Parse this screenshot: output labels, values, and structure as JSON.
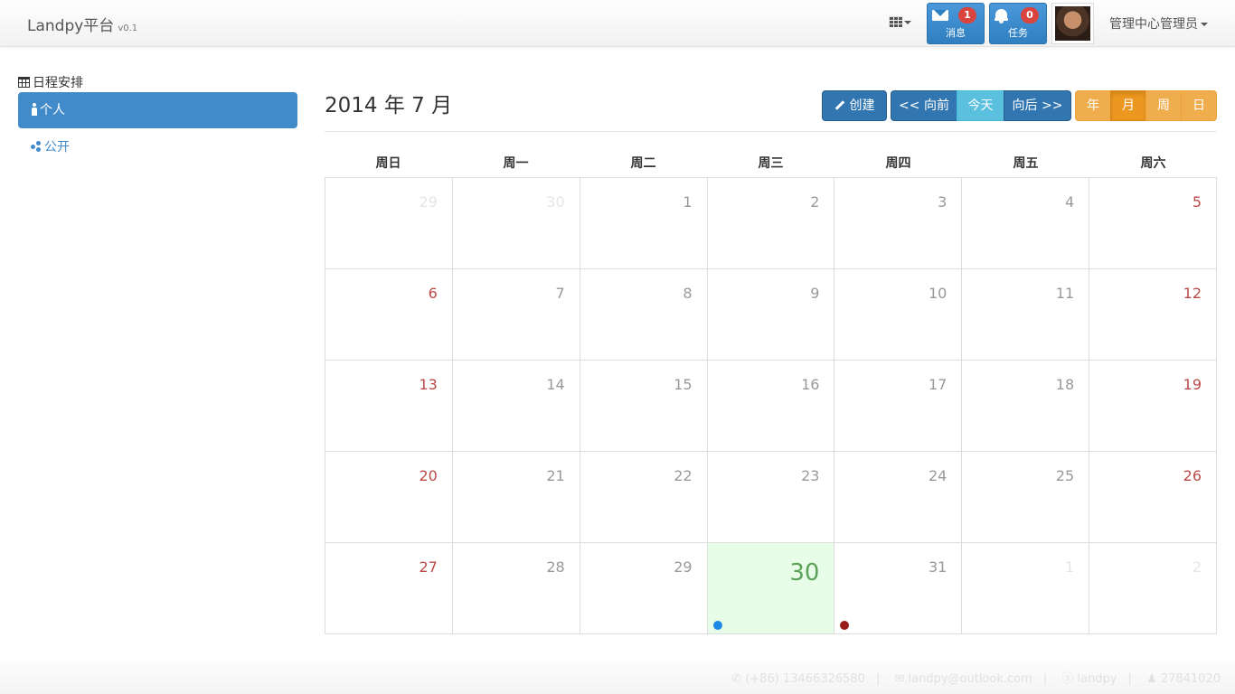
{
  "navbar": {
    "brand": "Landpy平台",
    "version": "v0.1",
    "messages": {
      "label": "消息",
      "count": "1"
    },
    "tasks": {
      "label": "任务",
      "count": "0"
    },
    "user": "管理中心管理员"
  },
  "sidebar": {
    "title": "日程安排",
    "items": [
      {
        "label": "个人"
      },
      {
        "label": "公开"
      }
    ]
  },
  "calendar": {
    "title": "2014 年 7 月",
    "buttons": {
      "create": "创建",
      "prev": "<< 向前",
      "today": "今天",
      "next": "向后 >>",
      "year": "年",
      "month": "月",
      "week": "周",
      "day": "日"
    },
    "weekdays": [
      "周日",
      "周一",
      "周二",
      "周三",
      "周四",
      "周五",
      "周六"
    ],
    "weeks": [
      [
        "29",
        "30",
        "1",
        "2",
        "3",
        "4",
        "5"
      ],
      [
        "6",
        "7",
        "8",
        "9",
        "10",
        "11",
        "12"
      ],
      [
        "13",
        "14",
        "15",
        "16",
        "17",
        "18",
        "19"
      ],
      [
        "20",
        "21",
        "22",
        "23",
        "24",
        "25",
        "26"
      ],
      [
        "27",
        "28",
        "29",
        "30",
        "31",
        "1",
        "2"
      ]
    ],
    "event_colors": {
      "wed_30": "#1e88e5",
      "thu_31": "#9b1c1c"
    }
  },
  "footer": {
    "phone": "(+86) 13466326580",
    "email": "landpy@outlook.com",
    "skype": "landpy",
    "qq": "27841020"
  }
}
